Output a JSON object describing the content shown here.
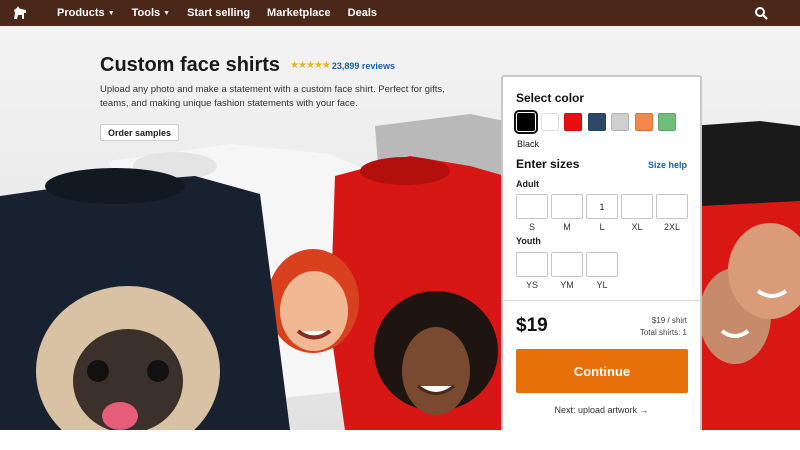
{
  "nav": {
    "logo_icon": "horse-logo-icon",
    "items": [
      {
        "label": "Products",
        "has_caret": true
      },
      {
        "label": "Tools",
        "has_caret": true
      },
      {
        "label": "Start selling",
        "has_caret": false
      },
      {
        "label": "Marketplace",
        "has_caret": false
      },
      {
        "label": "Deals",
        "has_caret": false
      }
    ],
    "search_icon": "search-icon",
    "bg_color": "#4a2718"
  },
  "hero": {
    "title": "Custom face shirts",
    "rating_stars": 4.5,
    "reviews": "23,899 reviews",
    "description": "Upload any photo and make a statement with a custom face shirt. Perfect for gifts, teams, and making unique fashion statements with your face.",
    "order_samples": "Order samples"
  },
  "panel": {
    "select_color": "Select color",
    "colors": [
      {
        "name": "Black",
        "hex": "#000000",
        "selected": true
      },
      {
        "name": "White",
        "hex": "#ffffff",
        "selected": false
      },
      {
        "name": "Red",
        "hex": "#e8100e",
        "selected": false
      },
      {
        "name": "Navy",
        "hex": "#2c4a66",
        "selected": false
      },
      {
        "name": "Gray",
        "hex": "#cfcfcf",
        "selected": false
      },
      {
        "name": "Orange",
        "hex": "#f5874a",
        "selected": false
      },
      {
        "name": "Green",
        "hex": "#6fbf7a",
        "selected": false
      }
    ],
    "selected_color_name": "Black",
    "enter_sizes": "Enter sizes",
    "size_help": "Size help",
    "adult_label": "Adult",
    "adult_sizes": [
      {
        "label": "S",
        "value": ""
      },
      {
        "label": "M",
        "value": ""
      },
      {
        "label": "L",
        "value": "1"
      },
      {
        "label": "XL",
        "value": ""
      },
      {
        "label": "2XL",
        "value": ""
      }
    ],
    "youth_label": "Youth",
    "youth_sizes": [
      {
        "label": "YS",
        "value": ""
      },
      {
        "label": "YM",
        "value": ""
      },
      {
        "label": "YL",
        "value": ""
      }
    ],
    "price": "$19",
    "per_shirt": "$19 / shirt",
    "total_shirts": "Total shirts: 1",
    "continue": "Continue",
    "next_step": "Next: upload artwork →",
    "accent_color": "#e8700a",
    "link_color": "#1a5fb4"
  }
}
